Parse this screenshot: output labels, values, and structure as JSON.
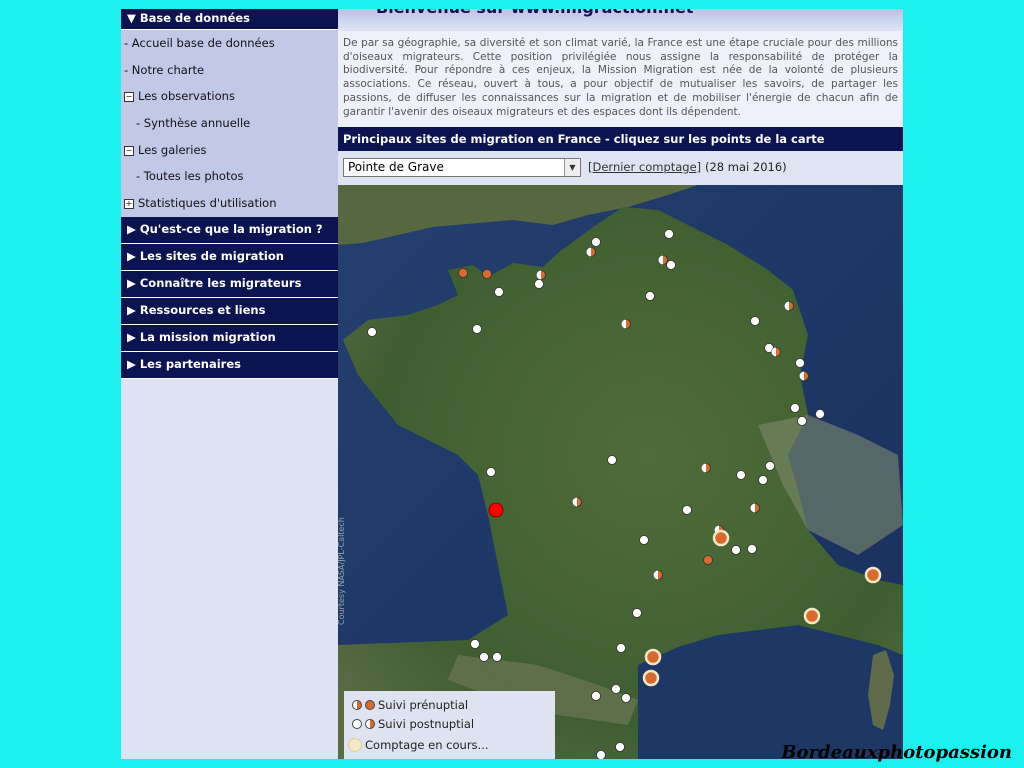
{
  "sidebar": {
    "header": "▼ Base de données",
    "items": [
      {
        "label": "- Accueil base de données"
      },
      {
        "label": "- Notre charte"
      },
      {
        "label": "Les observations",
        "toggle": "−"
      },
      {
        "label": "- Synthèse annuelle"
      },
      {
        "label": "Les galeries",
        "toggle": "−"
      },
      {
        "label": "- Toutes les photos"
      },
      {
        "label": "Statistiques d'utilisation",
        "toggle": "+"
      }
    ],
    "menu": [
      "▶ Qu'est-ce que la migration ?",
      "▶ Les sites de migration",
      "▶ Connaître les migrateurs",
      "▶ Ressources et liens",
      "▶ La mission migration",
      "▶ Les partenaires"
    ]
  },
  "main": {
    "banner": "Bienvenue sur www.migraction.net",
    "intro": "De par sa géographie, sa diversité et son climat varié, la France est une étape cruciale pour des millions d'oiseaux migrateurs. Cette position privilégiée nous assigne la responsabilité de protéger la biodiversité. Pour répondre à ces enjeux, la Mission Migration est née de la volonté de plusieurs associations. Ce réseau, ouvert à tous, a pour objectif de mutualiser les savoirs, de partager les passions, de diffuser les connaissances sur la migration et de mobiliser l'énergie de chacun afin de garantir l'avenir des oiseaux migrateurs et des espaces dont ils dépendent.",
    "sites_title": "Principaux sites de migration en France - cliquez sur les points de la carte",
    "select_value": "Pointe de Grave",
    "last_count_link": "[Dernier comptage]",
    "last_count_date": "(28 mai 2016)",
    "map_credit": "Courtesy NASA/JPL-Caltech",
    "legend": {
      "prenuptial": "Suivi prénuptial",
      "postnuptial": "Suivi postnuptial",
      "in_progress": "Comptage en cours..."
    }
  },
  "colors": {
    "nav_dark": "#0b1350",
    "background": "#1cf0ee",
    "orange_marker": "#d96a2f",
    "selected_marker": "#ff0000"
  },
  "watermark": "Bordeauxphotopassion"
}
